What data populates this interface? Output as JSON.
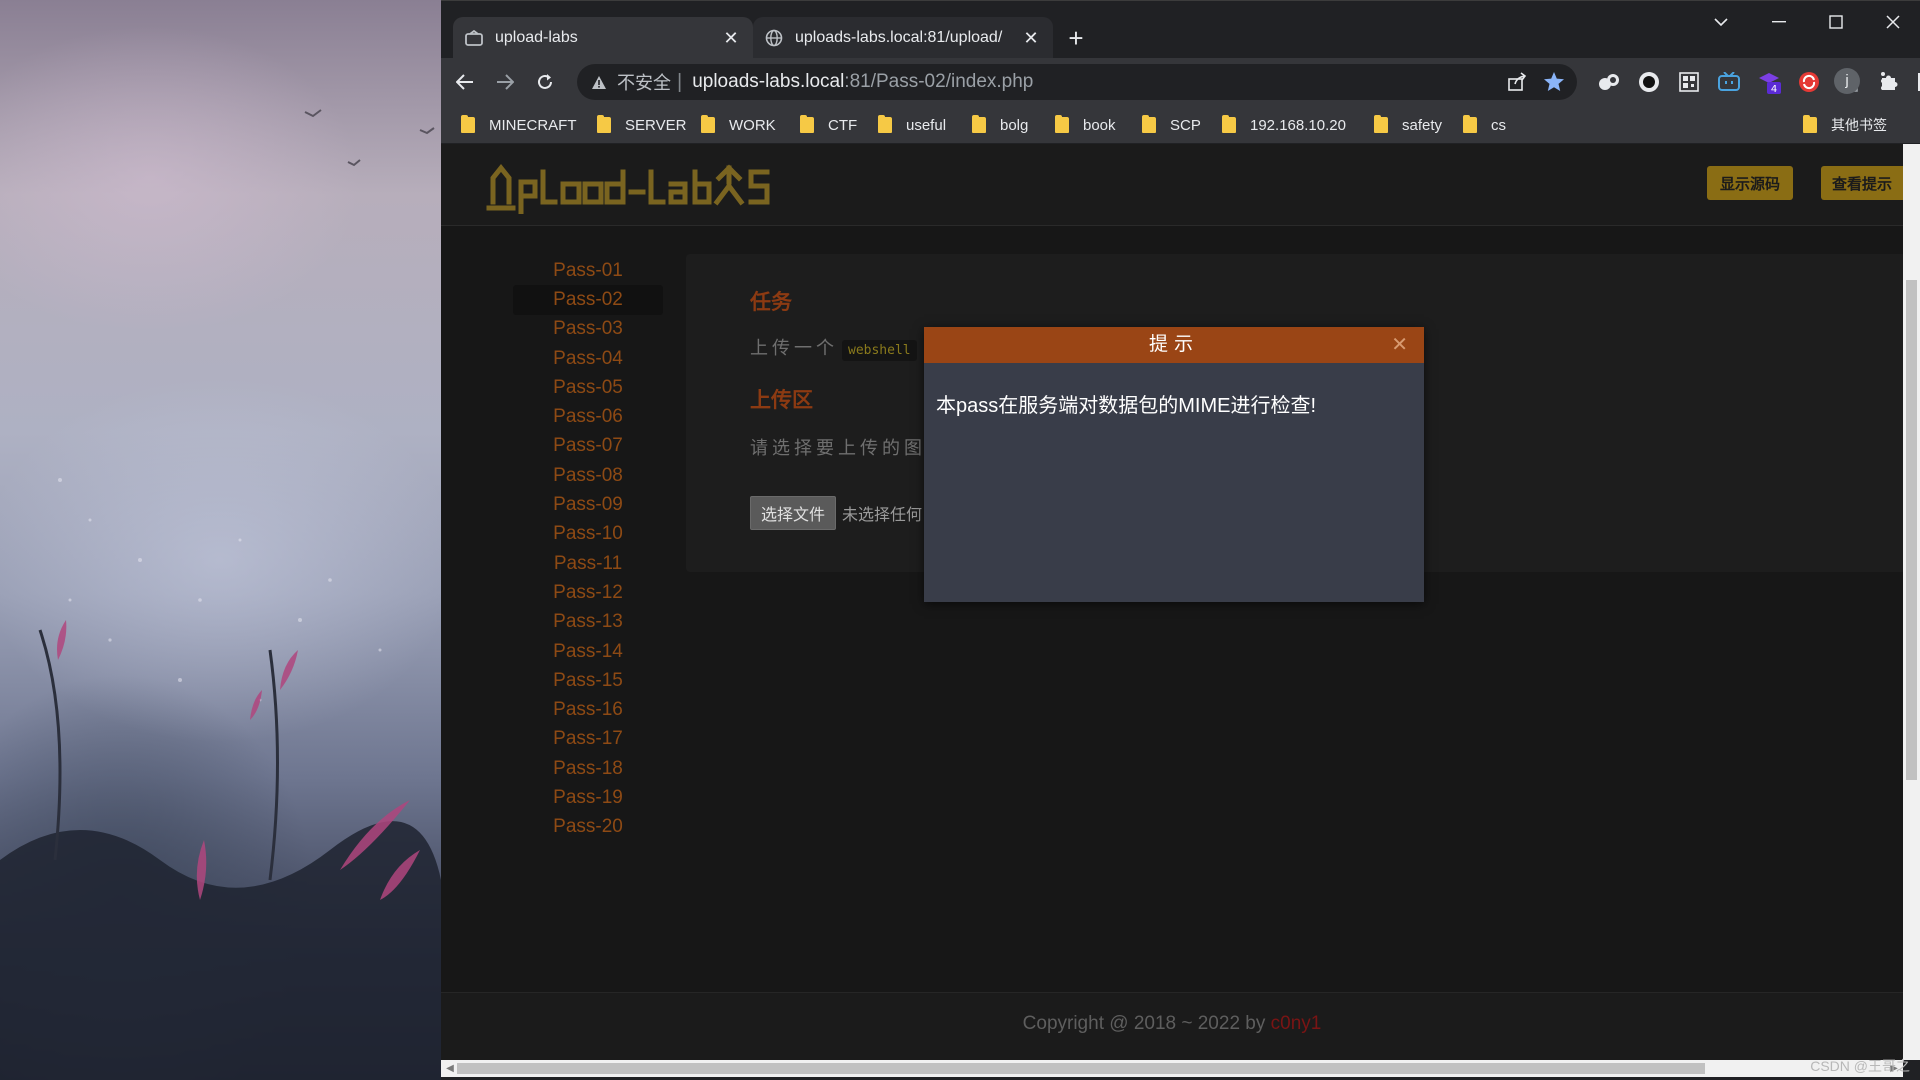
{
  "tabs": [
    {
      "title": "upload-labs",
      "active": true
    },
    {
      "title": "uploads-labs.local:81/upload/",
      "active": false
    }
  ],
  "address": {
    "insecure_label": "不安全",
    "host": "uploads-labs.local",
    "path": ":81/Pass-02/index.php"
  },
  "bookmarks": [
    "MINECRAFT",
    "SERVER",
    "WORK",
    "CTF",
    "useful",
    "bolg",
    "book",
    "SCP",
    "192.168.10.20",
    "safety",
    "cs"
  ],
  "other_bookmarks": "其他书签",
  "extension_badge": "4",
  "profile_initial": "j",
  "site": {
    "logo_text": "UpLoad-labS",
    "show_source_button": "显示源码",
    "show_hint_button": "查看提示"
  },
  "sidebar": {
    "items": [
      "Pass-01",
      "Pass-02",
      "Pass-03",
      "Pass-04",
      "Pass-05",
      "Pass-06",
      "Pass-07",
      "Pass-08",
      "Pass-09",
      "Pass-10",
      "Pass-11",
      "Pass-12",
      "Pass-13",
      "Pass-14",
      "Pass-15",
      "Pass-16",
      "Pass-17",
      "Pass-18",
      "Pass-19",
      "Pass-20"
    ],
    "active_index": 1
  },
  "content": {
    "task_title": "任务",
    "task_text_prefix": "上传一个",
    "task_code": "webshell",
    "upload_title": "上传区",
    "upload_text": "请选择要上传的图",
    "choose_file_button": "选择文件",
    "no_file_text": "未选择任何"
  },
  "modal": {
    "title": "提示",
    "close": "✕",
    "message": "本pass在服务端对数据包的MIME进行检查!"
  },
  "footer": {
    "text": "Copyright @ 2018 ~ 2022 by ",
    "author": "c0ny1"
  },
  "watermark": "CSDN @王哥之",
  "colors": {
    "accent_orange": "#9a4515",
    "sidebar_link": "#8e4a14",
    "header_button": "#8a6d14",
    "footer_author": "#7a1414"
  }
}
